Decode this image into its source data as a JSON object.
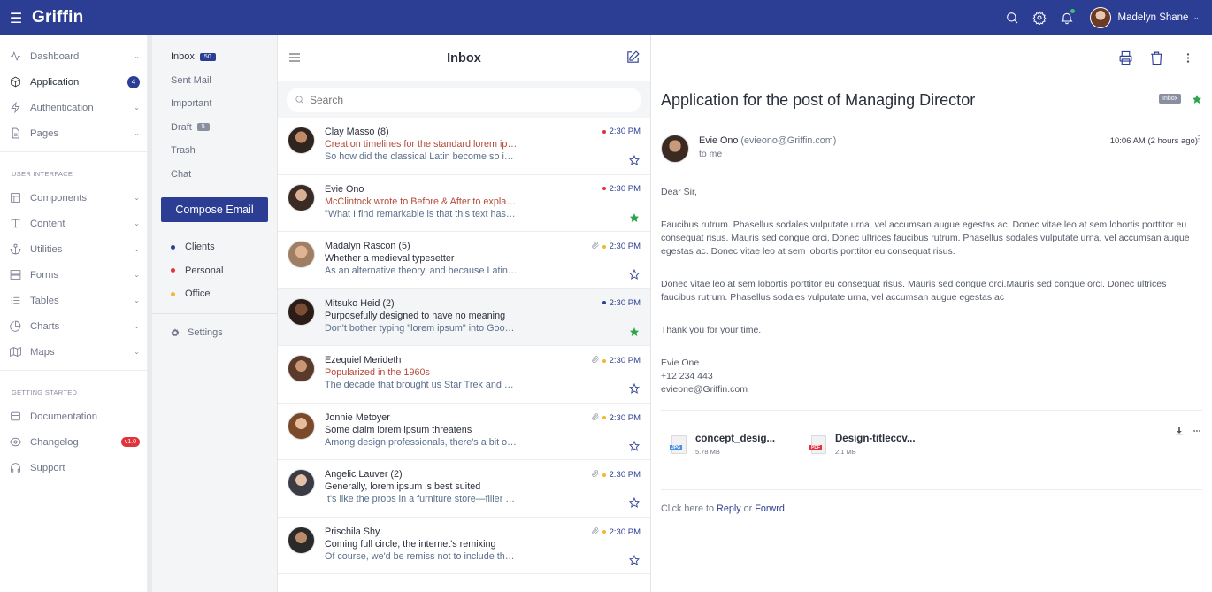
{
  "topbar": {
    "brand": "Griffin",
    "user_name": "Madelyn Shane"
  },
  "sidebar": {
    "items": [
      {
        "label": "Dashboard",
        "icon": "activity-icon"
      },
      {
        "label": "Application",
        "icon": "cube-icon",
        "badge": "4"
      },
      {
        "label": "Authentication",
        "icon": "zap-icon"
      },
      {
        "label": "Pages",
        "icon": "file-icon"
      }
    ],
    "section_ui": "USER INTERFACE",
    "ui_items": [
      {
        "label": "Components",
        "icon": "layout-icon"
      },
      {
        "label": "Content",
        "icon": "type-icon"
      },
      {
        "label": "Utilities",
        "icon": "anchor-icon"
      },
      {
        "label": "Forms",
        "icon": "server-icon"
      },
      {
        "label": "Tables",
        "icon": "list-icon"
      },
      {
        "label": "Charts",
        "icon": "pie-chart-icon"
      },
      {
        "label": "Maps",
        "icon": "map-icon"
      }
    ],
    "section_start": "GETTING STARTED",
    "start_items": [
      {
        "label": "Documentation",
        "icon": "book-icon"
      },
      {
        "label": "Changelog",
        "icon": "eye-icon",
        "badge": "v1.0"
      },
      {
        "label": "Support",
        "icon": "headphones-icon"
      }
    ]
  },
  "mailnav": {
    "items": [
      {
        "label": "Inbox",
        "count": "50"
      },
      {
        "label": "Sent Mail"
      },
      {
        "label": "Important"
      },
      {
        "label": "Draft",
        "count": "5"
      },
      {
        "label": "Trash"
      },
      {
        "label": "Chat"
      }
    ],
    "compose_label": "Compose Email",
    "labels": [
      {
        "label": "Clients",
        "color": "#2c3e93"
      },
      {
        "label": "Personal",
        "color": "#e0343b"
      },
      {
        "label": "Office",
        "color": "#f5b731"
      }
    ],
    "settings_label": "Settings"
  },
  "list": {
    "title": "Inbox",
    "search_placeholder": "Search",
    "messages": [
      {
        "from": "Clay Masso (8)",
        "subject": "Creation timelines for the standard lorem ipsum passage",
        "preview": "So how did the classical Latin become so incoherent?",
        "time": "2:30 PM",
        "dot": "#e0343b",
        "attach": false,
        "starred": false,
        "subject_red": true
      },
      {
        "from": "Evie Ono",
        "subject": "McClintock wrote to Before & After to explain his discovery",
        "preview": "\"What I find remarkable is that this text has been the industry's standard",
        "time": "2:30 PM",
        "dot": "#e0343b",
        "attach": false,
        "starred": true,
        "subject_red": true
      },
      {
        "from": "Madalyn Rascon (5)",
        "subject": "Whether a medieval typesetter",
        "preview": "As an alternative theory, and because Latin scholars do this sort of thing",
        "time": "2:30 PM",
        "dot": "#f5b731",
        "attach": true,
        "starred": false,
        "subject_red": false
      },
      {
        "from": "Mitsuko Heid (2)",
        "subject": "Purposefully designed to have no meaning",
        "preview": "Don't bother typing \"lorem ipsum\" into Google translate",
        "time": "2:30 PM",
        "dot": "#2c3e93",
        "attach": false,
        "starred": true,
        "subject_red": false
      },
      {
        "from": "Ezequiel Merideth",
        "subject": "Popularized in the 1960s",
        "preview": "The decade that brought us Star Trek and Doctor Who also resurrected Cicero",
        "time": "2:30 PM",
        "dot": "#f5b731",
        "attach": true,
        "starred": false,
        "subject_red": true
      },
      {
        "from": "Jonnie Metoyer",
        "subject": "Some claim lorem ipsum threatens",
        "preview": "Among design professionals, there's a bit of controversy surrounding the filler",
        "time": "2:30 PM",
        "dot": "#f5b731",
        "attach": true,
        "starred": false,
        "subject_red": false
      },
      {
        "from": "Angelic Lauver (2)",
        "subject": "Generally, lorem ipsum is best suited",
        "preview": "It's like the props in a furniture store—filler text makes it look like",
        "time": "2:30 PM",
        "dot": "#f5b731",
        "attach": true,
        "starred": false,
        "subject_red": false
      },
      {
        "from": "Prischila Shy",
        "subject": "Coming full circle, the internet's remixing",
        "preview": "Of course, we'd be remiss not to include the veritable cottage industry",
        "time": "2:30 PM",
        "dot": "#f5b731",
        "attach": true,
        "starred": false,
        "subject_red": false
      }
    ]
  },
  "reader": {
    "subject": "Application for the post of Managing Director",
    "tag": "Inbox",
    "from_name": "Evie Ono",
    "from_email": "(evieono@Griffin.com)",
    "to": "to me",
    "time": "10:06 AM (2 hours ago)",
    "greeting": "Dear Sir,",
    "para1": "Faucibus rutrum. Phasellus sodales vulputate urna, vel accumsan augue egestas ac. Donec vitae leo at sem lobortis porttitor eu consequat risus. Mauris sed congue orci. Donec ultrices faucibus rutrum. Phasellus sodales vulputate urna, vel accumsan augue egestas ac. Donec vitae leo at sem lobortis porttitor eu consequat risus.",
    "para2": "Donec vitae leo at sem lobortis porttitor eu consequat risus. Mauris sed congue orci.Mauris sed congue orci. Donec ultrices faucibus rutrum. Phasellus sodales vulputate urna, vel accumsan augue egestas ac",
    "thanks": "Thank you for your time.",
    "sig_name": "Evie One",
    "sig_phone": "+12 234 443",
    "sig_email": "evieone@Griffin.com",
    "attachments": [
      {
        "name": "concept_desig...",
        "size": "5.78 MB",
        "type": "JPG",
        "color": "#4a8fe0"
      },
      {
        "name": "Design-titleccv...",
        "size": "2.1 MB",
        "type": "PDF",
        "color": "#e0343b"
      }
    ],
    "reply_prefix": "Click here to",
    "reply_label": "Reply",
    "reply_or": "or",
    "forward_label": "Forwrd"
  }
}
